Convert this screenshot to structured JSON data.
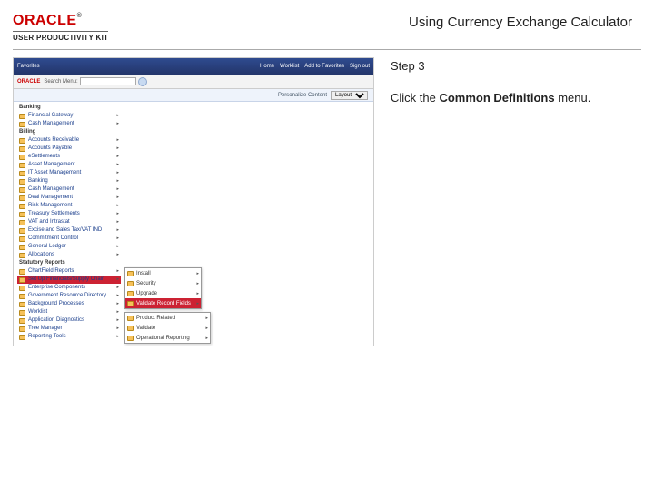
{
  "brand": {
    "name": "ORACLE",
    "tm": "®",
    "subtitle": "USER PRODUCTIVITY KIT"
  },
  "doc_title": "Using Currency Exchange Calculator",
  "instruction": {
    "step_label": "Step 3",
    "before": "Click the ",
    "bold": "Common Definitions",
    "after": " menu."
  },
  "app": {
    "top_left": "Favorites",
    "top_right": [
      "Home",
      "Worklist",
      "Add to Favorites",
      "Sign out"
    ],
    "oracle": "ORACLE",
    "menu_label": "Search Menu:",
    "search_value": "",
    "arrow": "»",
    "personalize_label": "Personalize Content",
    "personalize_value": "Layout"
  },
  "nav": [
    {
      "type": "heading",
      "label": "Banking"
    },
    {
      "type": "item",
      "label": "Financial Gateway",
      "arrow": true
    },
    {
      "type": "item",
      "label": "Cash Management",
      "arrow": true
    },
    {
      "type": "heading",
      "label": "Billing"
    },
    {
      "type": "item",
      "label": "Accounts Receivable",
      "arrow": true
    },
    {
      "type": "item",
      "label": "Accounts Payable",
      "arrow": true
    },
    {
      "type": "item",
      "label": "eSettlements",
      "arrow": true
    },
    {
      "type": "item",
      "label": "Asset Management",
      "arrow": true
    },
    {
      "type": "item",
      "label": "IT Asset Management",
      "arrow": true
    },
    {
      "type": "item",
      "label": "Banking",
      "arrow": true
    },
    {
      "type": "item",
      "label": "Cash Management",
      "arrow": true
    },
    {
      "type": "item",
      "label": "Deal Management",
      "arrow": true
    },
    {
      "type": "item",
      "label": "Risk Management",
      "arrow": true
    },
    {
      "type": "item",
      "label": "Treasury Settlements",
      "arrow": true
    },
    {
      "type": "item",
      "label": "VAT and Intrastat",
      "arrow": true
    },
    {
      "type": "item",
      "label": "Excise and Sales Tax/VAT IND",
      "arrow": true
    },
    {
      "type": "item",
      "label": "Commitment Control",
      "arrow": true
    },
    {
      "type": "item",
      "label": "General Ledger",
      "arrow": true
    },
    {
      "type": "item",
      "label": "Allocations",
      "arrow": true
    },
    {
      "type": "heading",
      "label": "Statutory Reports"
    },
    {
      "type": "item",
      "label": "ChartField Reports",
      "arrow": true
    },
    {
      "type": "item",
      "label": "Set Up Financials/Supply Chain",
      "arrow": true,
      "active": true
    },
    {
      "type": "item",
      "label": "Enterprise Components",
      "arrow": true
    },
    {
      "type": "item",
      "label": "Government Resource Directory",
      "arrow": true
    },
    {
      "type": "item",
      "label": "Background Processes",
      "arrow": true
    },
    {
      "type": "item",
      "label": "Worklist",
      "arrow": true
    },
    {
      "type": "item",
      "label": "Application Diagnostics",
      "arrow": true
    },
    {
      "type": "item",
      "label": "Tree Manager",
      "arrow": true
    },
    {
      "type": "item",
      "label": "Reporting Tools",
      "arrow": true
    }
  ],
  "submenu1": [
    {
      "label": "Install",
      "arrow": true
    },
    {
      "label": "Security",
      "arrow": true
    },
    {
      "label": "Upgrade",
      "arrow": true
    },
    {
      "label": "Validate Record Fields",
      "arrow": true,
      "highlight": true
    }
  ],
  "submenu2": [
    {
      "label": "Product Related",
      "arrow": true
    },
    {
      "label": "Validate",
      "arrow": true
    },
    {
      "label": "Operational Reporting",
      "arrow": true
    }
  ]
}
